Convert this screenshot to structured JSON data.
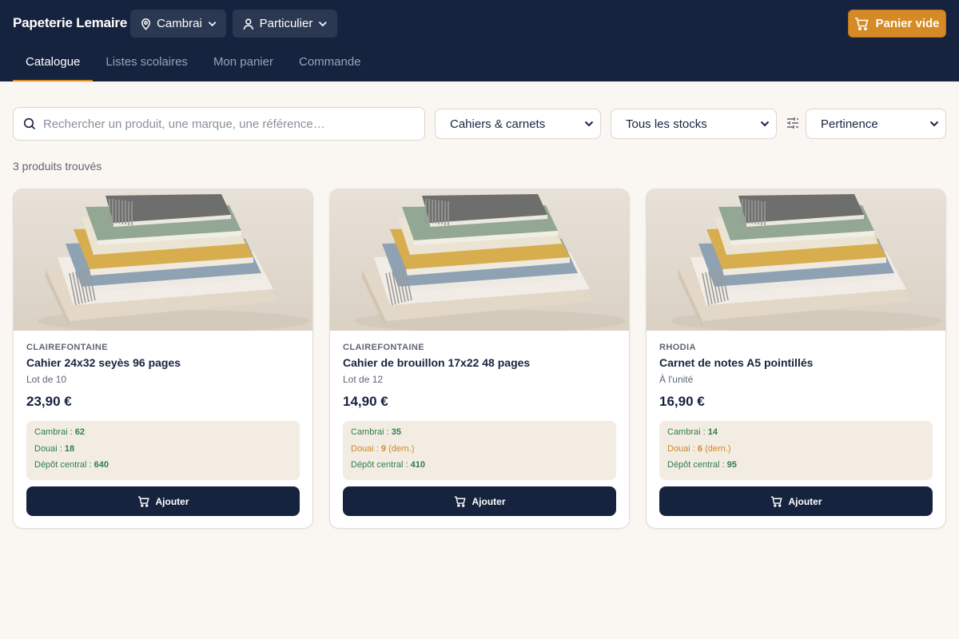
{
  "header": {
    "brand": "Papeterie Lemaire",
    "store": "Cambrai",
    "profile": "Particulier",
    "cart_label": "Panier vide",
    "tabs": [
      {
        "label": "Catalogue",
        "active": true
      },
      {
        "label": "Listes scolaires",
        "active": false
      },
      {
        "label": "Mon panier",
        "active": false
      },
      {
        "label": "Commande",
        "active": false
      }
    ]
  },
  "filters": {
    "search_placeholder": "Rechercher un produit, une marque, une référence…",
    "category": "Cahiers & carnets",
    "stock": "Tous les stocks",
    "sort": "Pertinence"
  },
  "results_count": "3 produits trouvés",
  "products": [
    {
      "brand": "CLAIREFONTAINE",
      "title": "Cahier 24x32 seyès 96 pages",
      "lot": "Lot de 10",
      "price": "23,90 €",
      "stock": [
        {
          "label": "Cambrai :",
          "qty": "62",
          "note": "",
          "low": false
        },
        {
          "label": "Douai :",
          "qty": "18",
          "note": "",
          "low": false
        },
        {
          "label": "Dépôt central :",
          "qty": "640",
          "note": "",
          "low": false
        }
      ],
      "add_label": "Ajouter"
    },
    {
      "brand": "CLAIREFONTAINE",
      "title": "Cahier de brouillon 17x22 48 pages",
      "lot": "Lot de 12",
      "price": "14,90 €",
      "stock": [
        {
          "label": "Cambrai :",
          "qty": "35",
          "note": "",
          "low": false
        },
        {
          "label": "Douai :",
          "qty": "9",
          "note": "(dern.)",
          "low": true
        },
        {
          "label": "Dépôt central :",
          "qty": "410",
          "note": "",
          "low": false
        }
      ],
      "add_label": "Ajouter"
    },
    {
      "brand": "RHODIA",
      "title": "Carnet de notes A5 pointillés",
      "lot": "À l'unité",
      "price": "16,90 €",
      "stock": [
        {
          "label": "Cambrai :",
          "qty": "14",
          "note": "",
          "low": false
        },
        {
          "label": "Douai :",
          "qty": "6",
          "note": "(dern.)",
          "low": true
        },
        {
          "label": "Dépôt central :",
          "qty": "95",
          "note": "",
          "low": false
        }
      ],
      "add_label": "Ajouter"
    }
  ],
  "colors": {
    "navy": "#16233f",
    "accent": "#d58a25",
    "stock_ok": "#2d7f4b",
    "stock_low": "#cd8a27"
  },
  "icons": [
    "location-pin-icon",
    "user-icon",
    "chevron-down-icon",
    "cart-icon",
    "search-icon",
    "sliders-icon"
  ]
}
